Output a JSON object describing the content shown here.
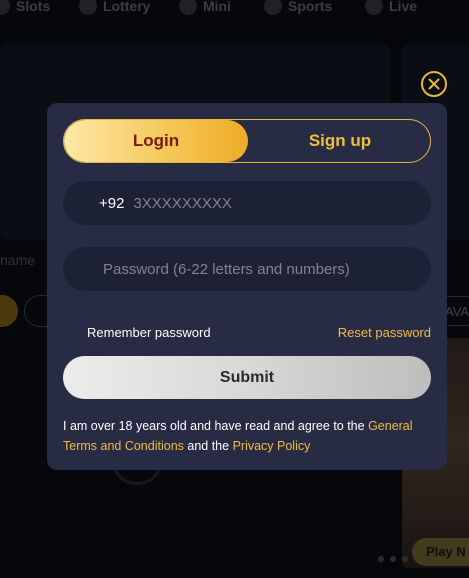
{
  "nav": {
    "items": [
      "Slots",
      "Lottery",
      "Mini",
      "Sports",
      "Live"
    ]
  },
  "background": {
    "name_label": "name",
    "ava_label": "AVA",
    "play_now": "Play N"
  },
  "modal": {
    "tabs": {
      "login": "Login",
      "signup": "Sign up",
      "active": "login"
    },
    "phone": {
      "prefix": "+92",
      "placeholder": "3XXXXXXXXX",
      "value": ""
    },
    "password": {
      "placeholder": "Password (6-22 letters and numbers)",
      "value": ""
    },
    "remember_label": "Remember password",
    "reset_label": "Reset password",
    "submit_label": "Submit",
    "terms": {
      "prefix": "I am over 18 years old and have read and agree to the ",
      "link_terms": "General Terms and Conditions",
      "middle": " and the ",
      "link_privacy": "Privacy Policy"
    }
  },
  "colors": {
    "accent": "#e7b53a",
    "login_tab_text": "#7a1d14",
    "modal_bg": "#272b44",
    "field_bg": "#1d2136"
  },
  "icons": {
    "close": "close-icon"
  }
}
